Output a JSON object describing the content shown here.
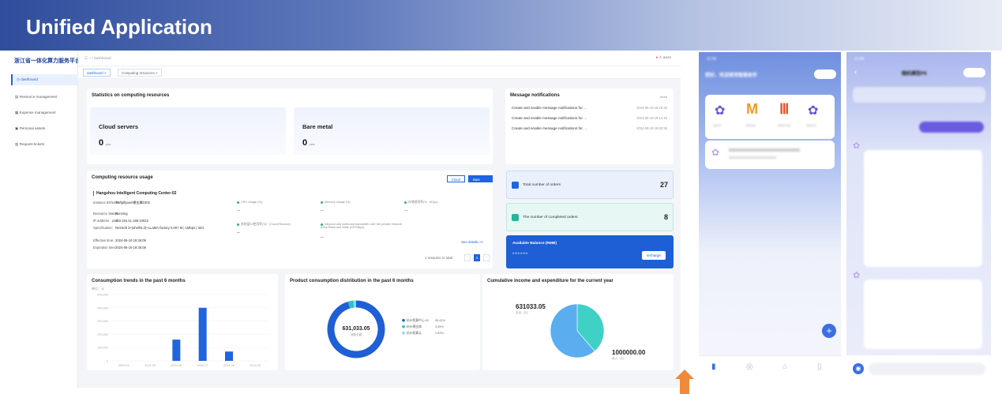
{
  "banner": {
    "title": "Unified Application"
  },
  "app": {
    "logo": "浙江省一体化算力服务平台",
    "breadcrumb": "⌂ / dashboard",
    "user_name": "aa12",
    "nav": [
      "dashboard",
      "Resource management",
      "Expense management",
      "Personal assets",
      "Request tickets"
    ],
    "tabs": [
      "dashboard ×",
      "Computing resources ×"
    ],
    "stats": {
      "title": "Statistics on computing resources",
      "items": [
        {
          "label": "Cloud servers",
          "value": "0",
          "unit": "pcs"
        },
        {
          "label": "Bare metal",
          "value": "0",
          "unit": "pcs"
        }
      ]
    },
    "messages": {
      "title": "Message notifications",
      "more": "more",
      "items": [
        {
          "text": "Create and enable message notifications for ...",
          "time": "2024-06-19 19:18:26"
        },
        {
          "text": "Create and enable message notifications for ...",
          "time": "2024-06-19 19:14:16"
        },
        {
          "text": "Create and enable message notifications for ...",
          "time": "2024-06-19 19:00:26"
        }
      ]
    },
    "usage": {
      "title": "Computing resource usage",
      "toggle": [
        "Cloud",
        "Bare metal"
      ],
      "center": "Hangzhou Intelligent Computing Center-02",
      "fields": [
        {
          "k": "Instance ID/Name:",
          "v": "TH/lglhjaav/裸金属0302"
        },
        {
          "k": "Resource Status:",
          "v": "Running"
        },
        {
          "k": "IP address · port:",
          "v": "103.154.41.186:10022"
        },
        {
          "k": "Specification:",
          "v": "ResSoft 3×(shell/3.3)+LLaMA-factory 0.007 M | 1Mbps | 32G"
        },
        {
          "k": "Effective time:",
          "v": "2024-06-19 19:36:08"
        },
        {
          "k": "Expiration time:",
          "v": "2024-06-19 19:36:08"
        }
      ],
      "metrics": [
        {
          "label": "CPU Usage (%)",
          "value": "--"
        },
        {
          "label": "Memory Usage (%)",
          "value": "--"
        },
        {
          "label": "存储使用率(% · 8Gpu)",
          "value": "--"
        },
        {
          "label": "系统盘IO使用率(%) · (Count/Second)",
          "value": "--"
        },
        {
          "label": "Inbound and outbound bandwidth over the private network (Disk Read and Write (KF/S)bps)",
          "value": "--"
        }
      ],
      "see_details": "See details >>",
      "pager_text": "1 resource in total",
      "page": "1"
    },
    "orders": {
      "label": "Total number of orders",
      "value": "27"
    },
    "completed": {
      "label": "The number of completed orders",
      "value": "8"
    },
    "balance": {
      "label": "Available Balance (RMB)",
      "value": "******",
      "button": "recharge"
    },
    "trends": {
      "title": "Consumption trends in the past 6 months"
    },
    "distribution": {
      "title": "Product consumption distribution in the past 6 months",
      "center_value": "631,033.05",
      "center_sub": "消费总额",
      "legend": [
        {
          "name": "杭州智算中心-02",
          "pct": "95.42%",
          "color": "#1f5fd6"
        },
        {
          "name": "杭州裸金属",
          "pct": "3.05%",
          "color": "#2bc3c0"
        },
        {
          "name": "杭州智算云",
          "pct": "1.53%",
          "color": "#8fd6f0"
        }
      ]
    },
    "cumulative": {
      "title": "Cumulative income and expenditure for the current year",
      "expense": "631033.05",
      "expense_sub": "支出（元）",
      "income": "1000000.00",
      "income_sub": "收入（元）"
    }
  },
  "chart_data": [
    {
      "type": "bar",
      "title": "Consumption trends in the past 6 months",
      "ylabel": "单位：元",
      "categories": [
        "2024-04",
        "2024-05",
        "2024-06",
        "2024-07",
        "2024-08",
        "2024-09"
      ],
      "values": [
        0,
        0,
        160000,
        400000,
        70000,
        0
      ],
      "yticks": [
        "0",
        "100,000",
        "200,000",
        "300,000",
        "400,000",
        "500,000"
      ],
      "ylim": [
        0,
        500000
      ],
      "color": "#1f64e0"
    },
    {
      "type": "pie",
      "title": "Product consumption distribution in the past 6 months",
      "labels": [
        "杭州智算中心-02",
        "杭州裸金属",
        "杭州智算云"
      ],
      "values": [
        95.42,
        3.05,
        1.53
      ]
    },
    {
      "type": "pie",
      "title": "Cumulative income and expenditure for the current year",
      "labels": [
        "支出（元）",
        "收入（元）"
      ],
      "values": [
        631033.05,
        1000000.0
      ]
    }
  ],
  "phone1": {
    "time": "11:06",
    "greeting": "您好，欢迎使用智能助手",
    "apps": [
      "Qwen",
      "Mistral",
      "Baichuan",
      "Qwen2"
    ]
  },
  "phone2": {
    "time": "11:06",
    "title": "随机模型PK"
  }
}
